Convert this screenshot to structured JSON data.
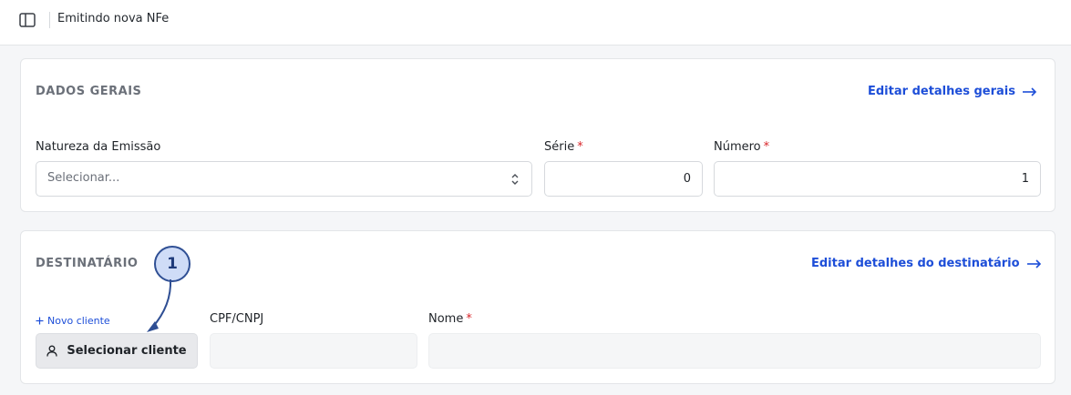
{
  "header": {
    "title": "Emitindo nova NFe",
    "sidebar_toggle_icon": "sidebar-panel-icon"
  },
  "general": {
    "section_title": "DADOS GERAIS",
    "edit_link": "Editar detalhes gerais",
    "natureza": {
      "label": "Natureza da Emissão",
      "placeholder": "Selecionar..."
    },
    "serie": {
      "label": "Série",
      "required_mark": "*",
      "value": "0"
    },
    "numero": {
      "label": "Número",
      "required_mark": "*",
      "value": "1"
    }
  },
  "recipient": {
    "section_title": "DESTINATÁRIO",
    "edit_link": "Editar detalhes do destinatário",
    "new_client_link": "Novo cliente",
    "select_client_button": "Selecionar cliente",
    "cpf_cnpj": {
      "label": "CPF/CNPJ",
      "value": ""
    },
    "nome": {
      "label": "Nome",
      "required_mark": "*",
      "value": ""
    }
  },
  "annotation": {
    "step_number": "1"
  },
  "colors": {
    "accent": "#1d4ed8",
    "required": "#d9262a",
    "badge_fill": "#cfdcf7",
    "badge_stroke": "#2f4f94"
  }
}
